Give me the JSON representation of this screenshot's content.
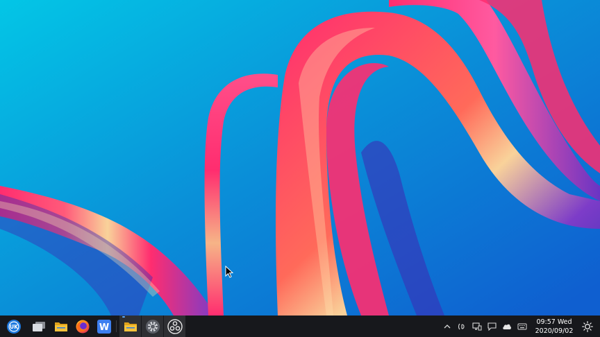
{
  "desktop": {
    "wallpaper": {
      "background_colors": [
        "#03c6e6",
        "#0a8fd8",
        "#0f5fd0"
      ],
      "ribbon_colors": [
        "#ff2d6f",
        "#ff6a5a",
        "#f9d29a",
        "#7d3cc8",
        "#3a2fb6"
      ]
    },
    "cursor_icon": "arrow-cursor-icon"
  },
  "taskbar": {
    "background": "#17181c",
    "start_button": {
      "label": "UK",
      "icon": "start-menu-icon"
    },
    "apps": [
      {
        "name": "multitasking-view",
        "icon": "multitasking-view-icon"
      },
      {
        "name": "file-manager",
        "icon": "folder-icon"
      },
      {
        "name": "firefox",
        "icon": "firefox-icon"
      },
      {
        "name": "wps-writer",
        "label": "W",
        "icon": "wps-writer-icon"
      },
      {
        "name": "file-manager-running",
        "icon": "folder-icon",
        "running": true
      },
      {
        "name": "settings",
        "icon": "settings-gear-icon"
      },
      {
        "name": "obs-studio",
        "icon": "obs-studio-icon"
      }
    ],
    "tray": [
      {
        "name": "show-hidden-icons",
        "icon": "chevron-up-icon"
      },
      {
        "name": "input-method",
        "icon": "input-method-icon"
      },
      {
        "name": "network",
        "icon": "network-icon"
      },
      {
        "name": "notifications",
        "icon": "notification-icon"
      },
      {
        "name": "cloud-sync",
        "icon": "cloud-icon"
      },
      {
        "name": "keyboard",
        "icon": "keyboard-icon"
      }
    ],
    "clock": {
      "time_day": "09:57 Wed",
      "date": "2020/09/02"
    },
    "theme_toggle": {
      "icon": "sun-icon"
    }
  }
}
